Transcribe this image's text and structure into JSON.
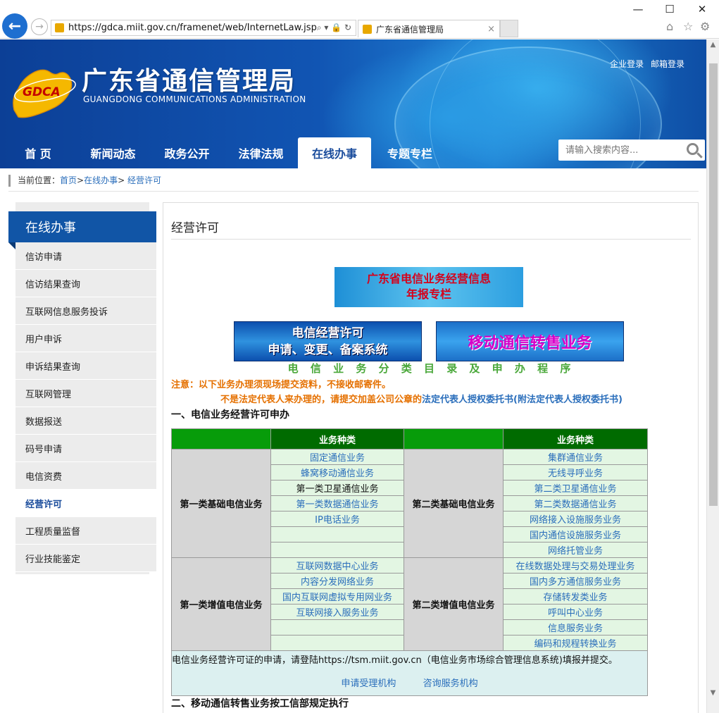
{
  "browser": {
    "back_icon": "arrow-left-icon",
    "url": "https://gdca.miit.gov.cn/framenet/web/InternetLaw.jsp",
    "addr_controls": "⌕ ▾ 🔒 ↻",
    "tab_title": "广东省通信管理局",
    "tab_close": "×",
    "minimize": "—",
    "maximize": "☐",
    "close": "✕",
    "home": "⌂",
    "favorites": "☆",
    "settings": "⚙"
  },
  "header": {
    "logo_text": "GDCA",
    "title": "广东省通信管理局",
    "subtitle": "GUANGDONG COMMUNICATIONS ADMINISTRATION",
    "links": [
      "企业登录",
      "邮箱登录"
    ],
    "nav": [
      "首 页",
      "新闻动态",
      "政务公开",
      "法律法规",
      "在线办事",
      "专题专栏"
    ],
    "search_placeholder": "请输入搜索内容..."
  },
  "breadcrumb": {
    "prefix": "当前位置：",
    "items": [
      "首页",
      "在线办事",
      "经营许可"
    ],
    "sep": ">"
  },
  "sidebar": {
    "title": "在线办事",
    "items": [
      "信访申请",
      "信访结果查询",
      "互联网信息服务投诉",
      "用户申诉",
      "申诉结果查询",
      "互联网管理",
      "数据报送",
      "码号申请",
      "电信资费",
      "经营许可",
      "工程质量监督",
      "行业技能鉴定"
    ],
    "active_index": 9
  },
  "content": {
    "title": "经营许可",
    "banner1_line1": "广东省电信业务经营信息",
    "banner1_line2": "年报专栏",
    "banner2_line1": "电信经营许可",
    "banner2_line2": "申请、变更、备案系统",
    "banner3": "移动通信转售业务",
    "catalog_title": "电 信 业 务 分 类 目 录 及 申 办 程 序",
    "note1": "注意：以下业务办理须现场提交资料，不接收邮寄件。",
    "note2_prefix": "不是法定代表人来办理的，请提交加盖公司公章的",
    "note2_link": "法定代表人授权委托书(附法定代表人授权委托书)",
    "section1": "一、电信业务经营许可申办",
    "section2": "二、移动通信转售业务按工信部规定执行"
  },
  "table": {
    "col_header": "业务种类",
    "groups": [
      {
        "left_cat": "第一类基础电信业务",
        "right_cat": "第二类基础电信业务",
        "rows": [
          [
            "固定通信业务",
            "集群通信业务"
          ],
          [
            "蜂窝移动通信业务",
            "无线寻呼业务"
          ],
          [
            "第一类卫星通信业务",
            "第二类卫星通信业务"
          ],
          [
            "第一类数据通信业务",
            "第二类数据通信业务"
          ],
          [
            "IP电话业务",
            "网络接入设施服务业务"
          ],
          [
            "",
            "国内通信设施服务业务"
          ],
          [
            "",
            "网络托管业务"
          ]
        ]
      },
      {
        "left_cat": "第一类增值电信业务",
        "right_cat": "第二类增值电信业务",
        "rows": [
          [
            "互联网数据中心业务",
            "在线数据处理与交易处理业务"
          ],
          [
            "内容分发网络业务",
            "国内多方通信服务业务"
          ],
          [
            "国内互联网虚拟专用网业务",
            "存储转发类业务"
          ],
          [
            "互联网接入服务业务",
            "呼叫中心业务"
          ],
          [
            "",
            "信息服务业务"
          ],
          [
            "",
            "编码和规程转换业务"
          ]
        ]
      }
    ],
    "footer_text": "电信业务经营许可证的申请，请登陆https://tsm.miit.gov.cn（电信业务市场综合管理信息系统)填报并提交。",
    "footer_links": [
      "申请受理机构",
      "咨询服务机构"
    ]
  }
}
